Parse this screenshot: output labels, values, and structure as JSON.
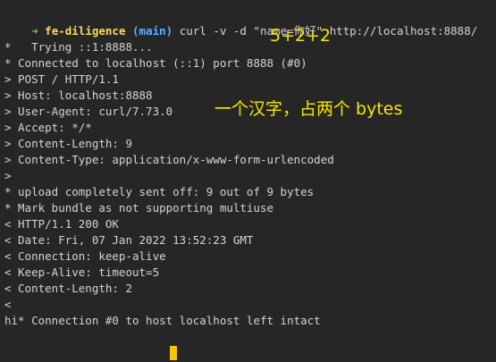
{
  "prompt": {
    "arrow": "➜",
    "dir": "fe-diligence",
    "branch": "(main)"
  },
  "command": "curl -v -d \"name=你好\" http://localhost:8888/",
  "output": [
    "*   Trying ::1:8888...",
    "* Connected to localhost (::1) port 8888 (#0)",
    "> POST / HTTP/1.1",
    "> Host: localhost:8888",
    "> User-Agent: curl/7.73.0",
    "> Accept: */*",
    "> Content-Length: 9",
    "> Content-Type: application/x-www-form-urlencoded",
    ">",
    "* upload completely sent off: 9 out of 9 bytes",
    "* Mark bundle as not supporting multiuse",
    "< HTTP/1.1 200 OK",
    "< Date: Fri, 07 Jan 2022 13:52:23 GMT",
    "< Connection: keep-alive",
    "< Keep-Alive: timeout=5",
    "< Content-Length: 2",
    "<",
    "hi* Connection #0 to host localhost left intact"
  ],
  "annotations": {
    "sum": "5+2+2",
    "note": "一个汉字，占两个 bytes"
  },
  "colors": {
    "background": "#262626",
    "annotation": "#f7e600",
    "arrow": "#5fd75f",
    "dir": "#ffd75f",
    "branch": "#5fafff"
  }
}
